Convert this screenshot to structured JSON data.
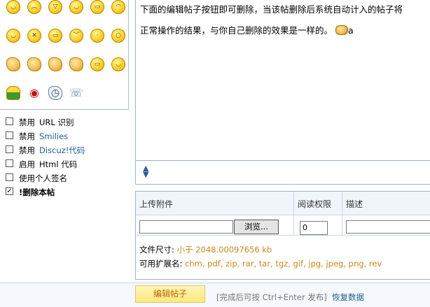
{
  "smilies": [
    {
      "name": "smile",
      "glyph": "◡"
    },
    {
      "name": "sad",
      "glyph": "︵"
    },
    {
      "name": "big-grin",
      "glyph": "▽"
    },
    {
      "name": "wink",
      "glyph": "◡"
    },
    {
      "name": "laugh",
      "glyph": "▭"
    },
    {
      "name": "tongue",
      "glyph": "◠"
    },
    {
      "name": "shy",
      "glyph": "◡"
    },
    {
      "name": "angry",
      "glyph": "✕"
    },
    {
      "name": "mad",
      "glyph": "▭"
    },
    {
      "name": "cry",
      "glyph": "︶"
    },
    {
      "name": "thinking",
      "glyph": "·"
    },
    {
      "name": "surprised",
      "glyph": "○"
    },
    {
      "name": "point-left",
      "glyph": ""
    },
    {
      "name": "point-right",
      "glyph": ""
    },
    {
      "name": "victory",
      "glyph": ""
    },
    {
      "name": "handshake",
      "glyph": ""
    },
    {
      "name": "grimace",
      "glyph": "▭"
    },
    {
      "name": "cool",
      "glyph": "◡"
    },
    {
      "name": "person",
      "glyph": ""
    },
    {
      "name": "lips",
      "glyph": ""
    },
    {
      "name": "clock",
      "glyph": ""
    },
    {
      "name": "phone",
      "glyph": ""
    }
  ],
  "options": [
    {
      "prefix": "禁用",
      "label": "URL 识别",
      "checked": false,
      "style": "plain"
    },
    {
      "prefix": "禁用",
      "label": "Smilies",
      "checked": false,
      "style": "blue"
    },
    {
      "prefix": "禁用",
      "label": "Discuz!代码",
      "checked": false,
      "style": "blue"
    },
    {
      "prefix": "启用",
      "label": "Html 代码",
      "checked": false,
      "style": "plain"
    },
    {
      "prefix": "",
      "label": "使用个人签名",
      "checked": false,
      "style": "plain"
    },
    {
      "prefix": "",
      "label": "!删除本帖",
      "checked": true,
      "style": "bold"
    }
  ],
  "editor": {
    "line1": "下面的编辑帖子按钮即可删除，当该帖删除后系统自动计入的帖子将",
    "line2": "正常操作的结果，与你自己删除的效果是一样的。",
    "line2_tail": "a"
  },
  "attachments": {
    "col_upload": "上传附件",
    "col_permission": "阅读权限",
    "col_description": "描述",
    "browse_label": "浏览...",
    "permission_value": "0",
    "filesize_label": "文件尺寸:",
    "filesize_value": "小于  2048.00097656 kb",
    "ext_label": "可用扩展名:",
    "ext_value": "chm, pdf, zip, rar, tar, tgz, gif, jpg, jpeg, png, rev"
  },
  "footer": {
    "submit_label": "编辑帖子",
    "hint": "[完成后可按  Ctrl+Enter 发布]",
    "restore_label": "恢复数据"
  }
}
